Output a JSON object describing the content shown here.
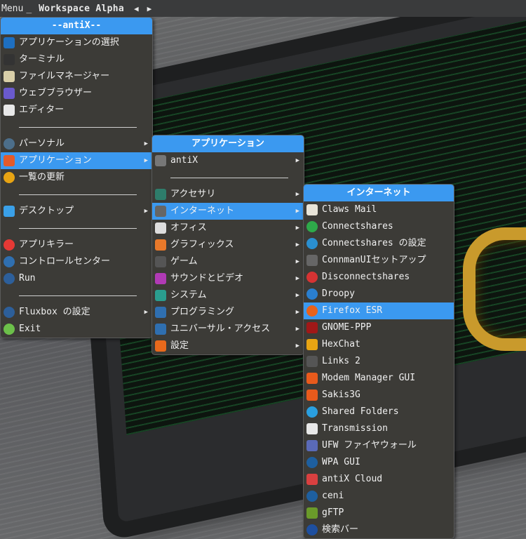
{
  "toolbar": {
    "menu": "Menu",
    "sep": "_",
    "workspace": "Workspace Alpha",
    "prev": "◀",
    "next": "▶"
  },
  "main_menu": {
    "title": "--antiX--",
    "items": [
      {
        "label": "アプリケーションの選択",
        "icon": "search-icon",
        "color": "#1e6fc0",
        "sub": false
      },
      {
        "label": "ターミナル",
        "icon": "terminal-icon",
        "color": "#333333",
        "sub": false
      },
      {
        "label": "ファイルマネージャー",
        "icon": "file-manager-icon",
        "color": "#d9cfa8",
        "sub": false
      },
      {
        "label": "ウェブブラウザー",
        "icon": "browser-icon",
        "color": "#6a5acd",
        "sub": false
      },
      {
        "label": "エディター",
        "icon": "editor-icon",
        "color": "#e8e8e8",
        "sub": false
      },
      {
        "sep": true
      },
      {
        "label": "パーソナル",
        "icon": "person-icon",
        "color": "#4c6e8a",
        "sub": true
      },
      {
        "label": "アプリケーション",
        "icon": "apps-grid-icon",
        "color": "#e35b2a",
        "sub": true,
        "active": true
      },
      {
        "label": "一覧の更新",
        "icon": "refresh-icon",
        "color": "#e8a413",
        "sub": false
      },
      {
        "sep": true
      },
      {
        "label": "デスクトップ",
        "icon": "desktop-icon",
        "color": "#3aa0e8",
        "sub": true
      },
      {
        "sep": true
      },
      {
        "label": "アプリキラー",
        "icon": "kill-icon",
        "color": "#e53935",
        "sub": false
      },
      {
        "label": "コントロールセンター",
        "icon": "control-center-icon",
        "color": "#2f6fb0",
        "sub": false
      },
      {
        "label": "Run",
        "icon": "run-gear-icon",
        "color": "#2d5f9a",
        "sub": false
      },
      {
        "sep": true
      },
      {
        "label": "Fluxbox の設定",
        "icon": "fluxbox-gear-icon",
        "color": "#2d5f9a",
        "sub": true
      },
      {
        "label": "Exit",
        "icon": "exit-icon",
        "color": "#6cc04a",
        "sub": false
      }
    ]
  },
  "apps_menu": {
    "title": "アプリケーション",
    "items": [
      {
        "label": "antiX",
        "icon": "antix-icon",
        "color": "#777777",
        "sub": true
      },
      {
        "sep": true
      },
      {
        "label": "アクセサリ",
        "icon": "accessories-icon",
        "color": "#2e7d6b",
        "sub": true
      },
      {
        "label": "インターネット",
        "icon": "network-icon",
        "color": "#666666",
        "sub": true,
        "active": true
      },
      {
        "label": "オフィス",
        "icon": "office-icon",
        "color": "#dddddd",
        "sub": true
      },
      {
        "label": "グラフィックス",
        "icon": "graphics-icon",
        "color": "#e9792a",
        "sub": true
      },
      {
        "label": "ゲーム",
        "icon": "games-icon",
        "color": "#555555",
        "sub": true
      },
      {
        "label": "サウンドとビデオ",
        "icon": "multimedia-icon",
        "color": "#b03ab5",
        "sub": true
      },
      {
        "label": "システム",
        "icon": "system-icon",
        "color": "#2a9d8f",
        "sub": true
      },
      {
        "label": "プログラミング",
        "icon": "programming-icon",
        "color": "#2f6fb0",
        "sub": true
      },
      {
        "label": "ユニバーサル・アクセス",
        "icon": "accessibility-icon",
        "color": "#2f6fb0",
        "sub": true
      },
      {
        "label": "設定",
        "icon": "settings-icon",
        "color": "#e8691c",
        "sub": true
      }
    ]
  },
  "internet_menu": {
    "title": "インターネット",
    "items": [
      {
        "label": "Claws Mail",
        "icon": "claws-mail-icon",
        "color": "#e8e4d8"
      },
      {
        "label": "Connectshares",
        "icon": "connectshares-icon",
        "color": "#2eaa4a"
      },
      {
        "label": "Connectshares の設定",
        "icon": "connectshares-config-icon",
        "color": "#2a8fd0"
      },
      {
        "label": "ConnmanUIセットアップ",
        "icon": "connman-icon",
        "color": "#666666"
      },
      {
        "label": "Disconnectshares",
        "icon": "disconnectshares-icon",
        "color": "#d63333"
      },
      {
        "label": "Droopy",
        "icon": "droopy-icon",
        "color": "#2a7fd0"
      },
      {
        "label": "Firefox ESR",
        "icon": "firefox-icon",
        "color": "#e8621c",
        "active": true
      },
      {
        "label": "GNOME-PPP",
        "icon": "gnome-ppp-icon",
        "color": "#a01818"
      },
      {
        "label": "HexChat",
        "icon": "hexchat-icon",
        "color": "#e8a413"
      },
      {
        "label": "Links 2",
        "icon": "links-icon",
        "color": "#555555"
      },
      {
        "label": "Modem Manager GUI",
        "icon": "modem-manager-icon",
        "color": "#e85a1c"
      },
      {
        "label": "Sakis3G",
        "icon": "sakis3g-icon",
        "color": "#e85a1c"
      },
      {
        "label": "Shared Folders",
        "icon": "shared-folders-icon",
        "color": "#2a9fe0"
      },
      {
        "label": "Transmission",
        "icon": "transmission-icon",
        "color": "#e8e8e8"
      },
      {
        "label": "UFW ファイヤウォール",
        "icon": "firewall-icon",
        "color": "#5a6ab8"
      },
      {
        "label": "WPA GUI",
        "icon": "wifi-icon",
        "color": "#1e5f9f"
      },
      {
        "label": "antiX Cloud",
        "icon": "cloud-icon",
        "color": "#d94040"
      },
      {
        "label": "ceni",
        "icon": "ceni-icon",
        "color": "#1e5f9f"
      },
      {
        "label": "gFTP",
        "icon": "gftp-icon",
        "color": "#6a9a2a"
      },
      {
        "label": "検索バー",
        "icon": "search-bar-eye-icon",
        "color": "#1e4f9f"
      }
    ]
  }
}
